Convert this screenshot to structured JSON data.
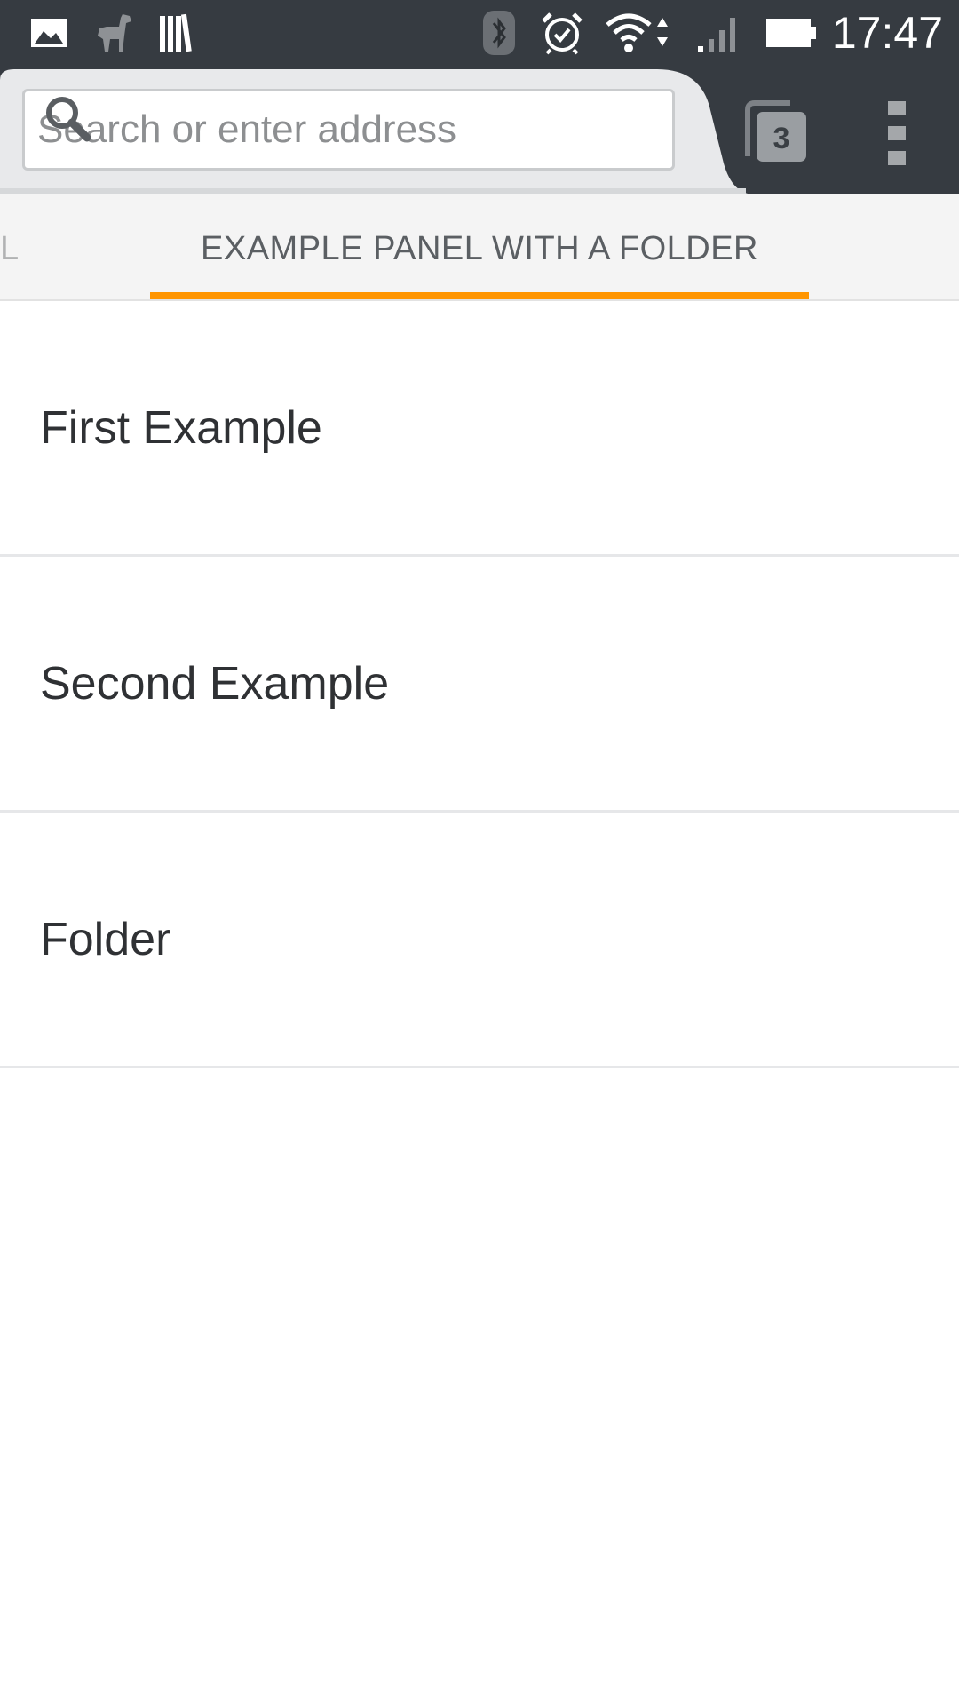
{
  "status_bar": {
    "time": "17:47",
    "icons": [
      "gallery-notification-icon",
      "alpaca-notification-icon",
      "library-notification-icon",
      "bluetooth-icon",
      "alarm-icon",
      "wifi-icon",
      "signal-icon",
      "battery-icon"
    ]
  },
  "toolbar": {
    "search_placeholder": "Search or enter address",
    "tabs_count": "3",
    "icons": [
      "search-icon",
      "tabs-icon",
      "overflow-menu-icon"
    ]
  },
  "panel_tabs": {
    "previous_tab_fragment": "L",
    "active_tab": "EXAMPLE PANEL WITH A FOLDER",
    "accent_color": "#ff9500"
  },
  "list": {
    "items": [
      {
        "label": "First Example"
      },
      {
        "label": "Second Example"
      },
      {
        "label": "Folder"
      }
    ]
  },
  "colors": {
    "chrome_dark": "#363b41",
    "tab_strip_bg": "#f4f4f4",
    "accent": "#ff9500"
  }
}
